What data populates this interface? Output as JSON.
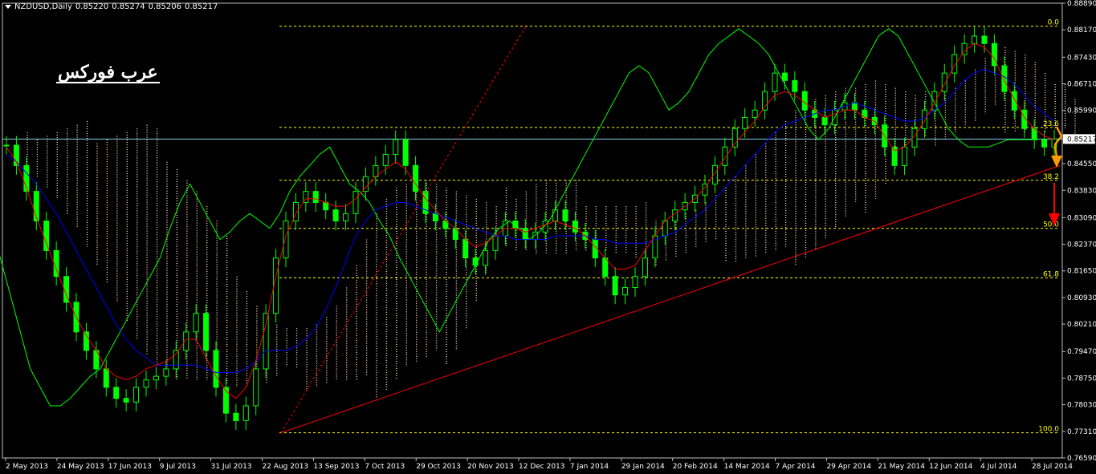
{
  "header": {
    "symbol": "NZDUSD,Daily",
    "open": "0.85220",
    "high": "0.85274",
    "low": "0.85206",
    "close": "0.85217"
  },
  "logo_text": "عرب فوركس",
  "colors": {
    "background": "#000000",
    "candles": "#00ff00",
    "chikou": "#00ff00",
    "tenkan": "#ff0000",
    "kijun": "#0000ff",
    "cloud": "#ffdab9",
    "fib_levels": "#ffff00",
    "trendline": "#ff0000",
    "price_line": "#87ceeb",
    "arrow_orange": "#ff9900",
    "arrow_red": "#ff0000"
  },
  "chart_data": {
    "type": "line",
    "title": "",
    "xlabel": "",
    "ylabel": "",
    "ylim": [
      0.7659,
      0.8889
    ],
    "y_ticks": [
      "0.88890",
      "0.88170",
      "0.87430",
      "0.86710",
      "0.85990",
      "0.85217",
      "0.84550",
      "0.83830",
      "0.83090",
      "0.82370",
      "0.81650",
      "0.80930",
      "0.80210",
      "0.79470",
      "0.78750",
      "0.78030",
      "0.77310",
      "0.76590"
    ],
    "current_price": "0.85217",
    "x_ticks": [
      "2 May 2013",
      "24 May 2013",
      "17 Jun 2013",
      "9 Jul 2013",
      "31 Jul 2013",
      "22 Aug 2013",
      "13 Sep 2013",
      "7 Oct 2013",
      "29 Oct 2013",
      "20 Nov 2013",
      "12 Dec 2013",
      "7 Jan 2014",
      "29 Jan 2014",
      "20 Feb 2014",
      "14 Mar 2014",
      "7 Apr 2014",
      "29 Apr 2014",
      "21 May 2014",
      "12 Jun 2014",
      "4 Jul 2014",
      "28 Jul 2014"
    ],
    "fib_levels": [
      {
        "label": "0.0",
        "price": 0.8827
      },
      {
        "label": "23.6",
        "price": 0.8553
      },
      {
        "label": "38.2",
        "price": 0.841
      },
      {
        "label": "50.0",
        "price": 0.828
      },
      {
        "label": "61.8",
        "price": 0.8146
      },
      {
        "label": "100.0",
        "price": 0.7727
      }
    ],
    "grid": false,
    "legend": "none",
    "series": [
      {
        "values": [
          0.8505,
          0.845,
          0.838,
          0.83,
          0.822,
          0.815,
          0.808,
          0.8,
          0.795,
          0.79,
          0.785,
          0.782,
          0.781,
          0.785,
          0.787,
          0.788,
          0.79,
          0.795,
          0.8,
          0.805,
          0.795,
          0.785,
          0.778,
          0.776,
          0.78,
          0.79,
          0.805,
          0.82,
          0.83,
          0.835,
          0.838,
          0.835,
          0.833,
          0.83,
          0.832,
          0.838,
          0.842,
          0.845,
          0.848,
          0.852,
          0.845,
          0.838,
          0.832,
          0.83,
          0.828,
          0.825,
          0.82,
          0.818,
          0.822,
          0.826,
          0.83,
          0.828,
          0.825,
          0.827,
          0.83,
          0.833,
          0.83,
          0.827,
          0.825,
          0.82,
          0.815,
          0.81,
          0.812,
          0.815,
          0.82,
          0.826,
          0.83,
          0.833,
          0.835,
          0.837,
          0.84,
          0.845,
          0.85,
          0.855,
          0.858,
          0.86,
          0.865,
          0.87,
          0.868,
          0.865,
          0.86,
          0.858,
          0.856,
          0.86,
          0.862,
          0.86,
          0.858,
          0.856,
          0.85,
          0.845,
          0.85,
          0.855,
          0.86,
          0.865,
          0.87,
          0.875,
          0.878,
          0.88,
          0.878,
          0.872,
          0.865,
          0.86,
          0.855,
          0.852,
          0.85,
          0.8522
        ]
      },
      {
        "values": [
          0.85,
          0.846,
          0.839,
          0.831,
          0.824,
          0.817,
          0.81,
          0.804,
          0.799,
          0.795,
          0.79,
          0.788,
          0.787,
          0.788,
          0.79,
          0.791,
          0.792,
          0.794,
          0.798,
          0.798,
          0.793,
          0.788,
          0.784,
          0.782,
          0.785,
          0.792,
          0.802,
          0.815,
          0.826,
          0.832,
          0.836,
          0.836,
          0.835,
          0.834,
          0.834,
          0.836,
          0.839,
          0.842,
          0.844,
          0.846,
          0.844,
          0.84,
          0.836,
          0.833,
          0.83,
          0.828,
          0.825,
          0.823,
          0.824,
          0.826,
          0.828,
          0.828,
          0.827,
          0.828,
          0.829,
          0.83,
          0.829,
          0.828,
          0.826,
          0.823,
          0.82,
          0.817,
          0.817,
          0.818,
          0.822,
          0.826,
          0.83,
          0.832,
          0.834,
          0.836,
          0.839,
          0.843,
          0.847,
          0.851,
          0.854,
          0.857,
          0.861,
          0.864,
          0.865,
          0.864,
          0.862,
          0.86,
          0.858,
          0.859,
          0.86,
          0.86,
          0.858,
          0.857,
          0.853,
          0.849,
          0.85,
          0.853,
          0.857,
          0.862,
          0.867,
          0.872,
          0.876,
          0.878,
          0.877,
          0.874,
          0.868,
          0.863,
          0.858,
          0.855,
          0.853,
          0.852
        ]
      },
      {
        "values": [
          0.848,
          0.846,
          0.843,
          0.84,
          0.836,
          0.832,
          0.827,
          0.822,
          0.817,
          0.812,
          0.807,
          0.802,
          0.798,
          0.795,
          0.793,
          0.791,
          0.791,
          0.791,
          0.791,
          0.791,
          0.79,
          0.789,
          0.789,
          0.789,
          0.79,
          0.792,
          0.795,
          0.795,
          0.795,
          0.796,
          0.798,
          0.801,
          0.806,
          0.812,
          0.819,
          0.826,
          0.83,
          0.833,
          0.834,
          0.835,
          0.835,
          0.834,
          0.833,
          0.832,
          0.831,
          0.83,
          0.829,
          0.828,
          0.827,
          0.826,
          0.826,
          0.825,
          0.825,
          0.825,
          0.825,
          0.826,
          0.826,
          0.826,
          0.826,
          0.825,
          0.825,
          0.824,
          0.824,
          0.824,
          0.824,
          0.825,
          0.826,
          0.827,
          0.829,
          0.831,
          0.833,
          0.836,
          0.839,
          0.842,
          0.845,
          0.848,
          0.851,
          0.854,
          0.856,
          0.857,
          0.858,
          0.859,
          0.86,
          0.86,
          0.861,
          0.862,
          0.861,
          0.86,
          0.859,
          0.858,
          0.857,
          0.857,
          0.858,
          0.86,
          0.862,
          0.865,
          0.868,
          0.87,
          0.871,
          0.87,
          0.869,
          0.867,
          0.864,
          0.861,
          0.859,
          0.857
        ]
      },
      {
        "values": [
          0.83,
          0.82,
          0.81,
          0.8,
          0.79,
          0.785,
          0.78,
          0.78,
          0.782,
          0.785,
          0.788,
          0.79,
          0.795,
          0.8,
          0.805,
          0.81,
          0.815,
          0.82,
          0.828,
          0.835,
          0.84,
          0.835,
          0.83,
          0.825,
          0.827,
          0.83,
          0.832,
          0.83,
          0.828,
          0.832,
          0.838,
          0.842,
          0.845,
          0.848,
          0.85,
          0.845,
          0.84,
          0.838,
          0.835,
          0.83,
          0.826,
          0.82,
          0.815,
          0.81,
          0.805,
          0.8,
          0.805,
          0.81,
          0.815,
          0.82,
          0.825,
          0.828,
          0.83,
          0.828,
          0.825,
          0.827,
          0.83,
          0.835,
          0.84,
          0.845,
          0.85,
          0.855,
          0.86,
          0.865,
          0.87,
          0.872,
          0.87,
          0.865,
          0.86,
          0.862,
          0.865,
          0.87,
          0.875,
          0.878,
          0.88,
          0.882,
          0.88,
          0.878,
          0.875,
          0.87,
          0.865,
          0.86,
          0.855,
          0.852,
          0.855,
          0.86,
          0.865,
          0.87,
          0.875,
          0.88,
          0.882,
          0.88,
          0.875,
          0.87,
          0.865,
          0.86,
          0.855,
          0.852,
          0.85,
          0.85,
          0.85,
          0.851,
          0.852,
          0.852,
          0.852,
          0.852
        ]
      }
    ]
  }
}
